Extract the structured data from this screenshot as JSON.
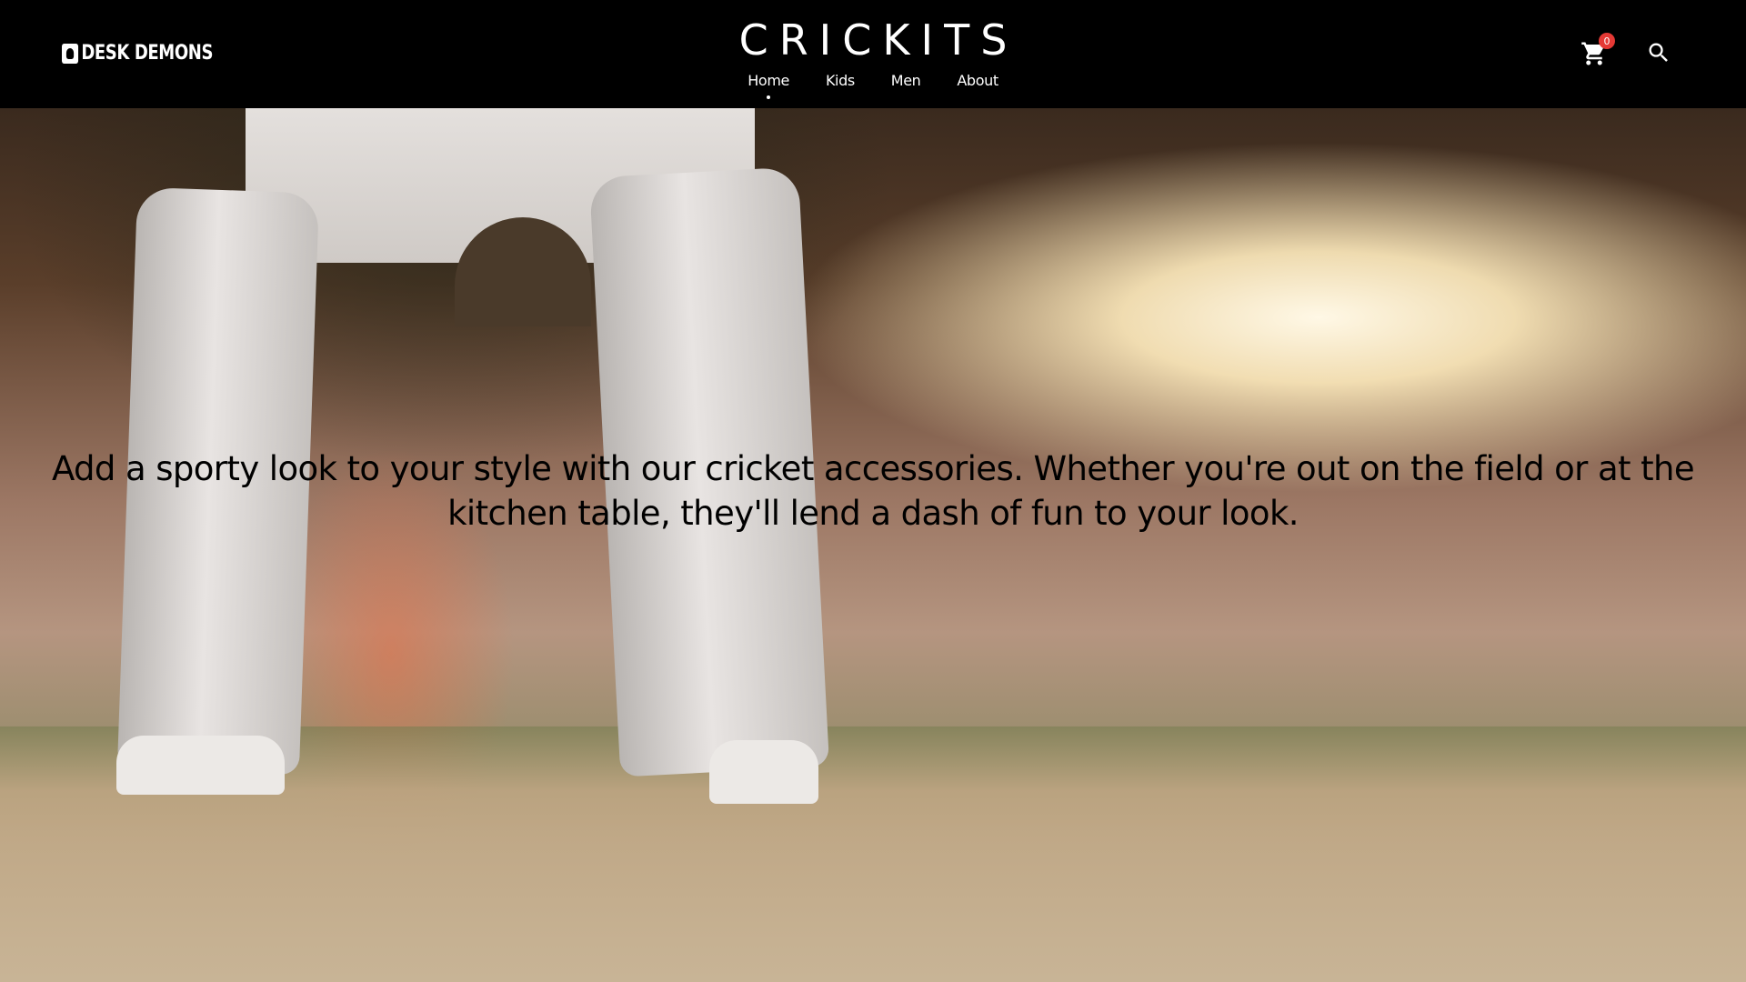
{
  "header": {
    "logo_text": "DESK DEMONS",
    "site_title": "CRICKITS",
    "nav": [
      {
        "label": "Home",
        "active": true
      },
      {
        "label": "Kids",
        "active": false
      },
      {
        "label": "Men",
        "active": false
      },
      {
        "label": "About",
        "active": false
      }
    ],
    "cart_count": "0",
    "cart_icon": "cart-icon",
    "search_icon": "search-icon",
    "cart_badge_color": "#e53935"
  },
  "hero": {
    "text": "Add a sporty look to your style with our cricket accessories. Whether you're out on the field or at the kitchen table, they'll lend a dash of fun to your look."
  }
}
